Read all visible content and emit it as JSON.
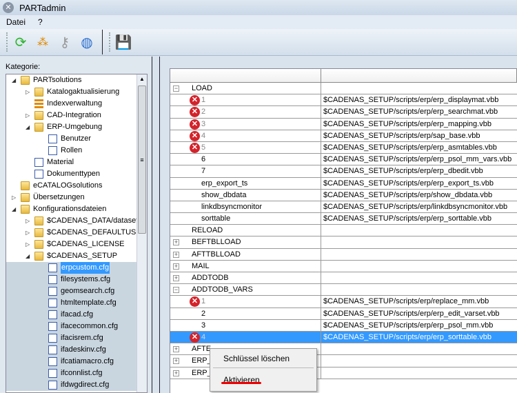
{
  "window": {
    "title": "PARTadmin"
  },
  "menu": [
    "Datei",
    "?"
  ],
  "toolbar": {
    "icons": [
      "refresh-icon",
      "tree-structure-icon",
      "keys-icon",
      "update-globe-icon",
      "save-icon"
    ]
  },
  "left": {
    "label": "Kategorie:",
    "tree": [
      {
        "label": "PARTsolutions",
        "level": 0,
        "icon": "folder",
        "exp": "open"
      },
      {
        "label": "Katalogaktualisierung",
        "level": 1,
        "icon": "folder",
        "exp": "closed"
      },
      {
        "label": "Indexverwaltung",
        "level": 1,
        "icon": "tree",
        "exp": ""
      },
      {
        "label": "CAD-Integration",
        "level": 1,
        "icon": "folder",
        "exp": "closed"
      },
      {
        "label": "ERP-Umgebung",
        "level": 1,
        "icon": "folder",
        "exp": "open"
      },
      {
        "label": "Benutzer",
        "level": 2,
        "icon": "doc",
        "exp": ""
      },
      {
        "label": "Rollen",
        "level": 2,
        "icon": "doc",
        "exp": ""
      },
      {
        "label": "Material",
        "level": 1,
        "icon": "doc",
        "exp": ""
      },
      {
        "label": "Dokumenttypen",
        "level": 1,
        "icon": "doc",
        "exp": ""
      },
      {
        "label": "eCATALOGsolutions",
        "level": 0,
        "icon": "folder",
        "exp": ""
      },
      {
        "label": "Übersetzungen",
        "level": 0,
        "icon": "folder",
        "exp": "closed"
      },
      {
        "label": "Konfigurationsdateien",
        "level": 0,
        "icon": "folder",
        "exp": "open"
      },
      {
        "label": "$CADENAS_DATA/datasetup",
        "level": 1,
        "icon": "folder",
        "exp": "closed"
      },
      {
        "label": "$CADENAS_DEFAULTUSER",
        "level": 1,
        "icon": "folder",
        "exp": "closed"
      },
      {
        "label": "$CADENAS_LICENSE",
        "level": 1,
        "icon": "folder",
        "exp": "closed"
      },
      {
        "label": "$CADENAS_SETUP",
        "level": 1,
        "icon": "folder",
        "exp": "open"
      },
      {
        "label": "erpcustom.cfg",
        "level": 2,
        "icon": "doc",
        "exp": "",
        "selected": true
      },
      {
        "label": "filesystems.cfg",
        "level": 2,
        "icon": "doc",
        "exp": ""
      },
      {
        "label": "geomsearch.cfg",
        "level": 2,
        "icon": "doc",
        "exp": ""
      },
      {
        "label": "htmltemplate.cfg",
        "level": 2,
        "icon": "doc",
        "exp": ""
      },
      {
        "label": "ifacad.cfg",
        "level": 2,
        "icon": "doc",
        "exp": ""
      },
      {
        "label": "ifacecommon.cfg",
        "level": 2,
        "icon": "doc",
        "exp": ""
      },
      {
        "label": "ifacisrem.cfg",
        "level": 2,
        "icon": "doc",
        "exp": ""
      },
      {
        "label": "ifadeskinv.cfg",
        "level": 2,
        "icon": "doc",
        "exp": ""
      },
      {
        "label": "ifcatiamacro.cfg",
        "level": 2,
        "icon": "doc",
        "exp": ""
      },
      {
        "label": "ifconnlist.cfg",
        "level": 2,
        "icon": "doc",
        "exp": ""
      },
      {
        "label": "ifdwgdirect.cfg",
        "level": 2,
        "icon": "doc",
        "exp": ""
      }
    ]
  },
  "grid": {
    "rows": [
      {
        "key": "LOAD",
        "value": "",
        "exp": "minus",
        "indent": 0
      },
      {
        "key": "1",
        "value": "$CADENAS_SETUP/scripts/erp/erp_displaymat.vbb",
        "err": true,
        "indent": 1
      },
      {
        "key": "2",
        "value": "$CADENAS_SETUP/scripts/erp/erp_searchmat.vbb",
        "err": true,
        "indent": 1
      },
      {
        "key": "3",
        "value": "$CADENAS_SETUP/scripts/erp/erp_mapping.vbb",
        "err": true,
        "indent": 1
      },
      {
        "key": "4",
        "value": "$CADENAS_SETUP/scripts/erp/sap_base.vbb",
        "err": true,
        "indent": 1
      },
      {
        "key": "5",
        "value": "$CADENAS_SETUP/scripts/erp/erp_asmtables.vbb",
        "err": true,
        "indent": 1
      },
      {
        "key": "6",
        "value": "$CADENAS_SETUP/scripts/erp/erp_psol_mm_vars.vbb",
        "indent": 1
      },
      {
        "key": "7",
        "value": "$CADENAS_SETUP/scripts/erp/erp_dbedit.vbb",
        "indent": 1
      },
      {
        "key": "erp_export_ts",
        "value": "$CADENAS_SETUP/scripts/erp/erp_export_ts.vbb",
        "indent": 1
      },
      {
        "key": "show_dbdata",
        "value": "$CADENAS_SETUP/scripts/erp/show_dbdata.vbb",
        "indent": 1
      },
      {
        "key": "linkdbsyncmonitor",
        "value": "$CADENAS_SETUP/scripts/erp/linkdbsyncmonitor.vbb",
        "indent": 1
      },
      {
        "key": "sorttable",
        "value": "$CADENAS_SETUP/scripts/erp/erp_sorttable.vbb",
        "indent": 1
      },
      {
        "key": "RELOAD",
        "value": "",
        "indent": 0
      },
      {
        "key": "BEFTBLLOAD",
        "value": "",
        "exp": "plus",
        "indent": 0
      },
      {
        "key": "AFTTBLLOAD",
        "value": "",
        "exp": "plus",
        "indent": 0
      },
      {
        "key": "MAIL",
        "value": "",
        "exp": "plus",
        "indent": 0
      },
      {
        "key": "ADDTODB",
        "value": "",
        "exp": "plus",
        "indent": 0
      },
      {
        "key": "ADDTODB_VARS",
        "value": "",
        "exp": "minus",
        "indent": 0
      },
      {
        "key": "1",
        "value": "$CADENAS_SETUP/scripts/erp/replace_mm.vbb",
        "err": true,
        "indent": 1
      },
      {
        "key": "2",
        "value": "$CADENAS_SETUP/scripts/erp/erp_edit_varset.vbb",
        "indent": 1
      },
      {
        "key": "3",
        "value": "$CADENAS_SETUP/scripts/erp/erp_psol_mm.vbb",
        "indent": 1
      },
      {
        "key": "4",
        "value": "$CADENAS_SETUP/scripts/erp/erp_sorttable.vbb",
        "err": true,
        "indent": 1,
        "selected": true
      },
      {
        "key": "AFTE",
        "value": "",
        "exp": "plus",
        "indent": 0
      },
      {
        "key": "ERP_",
        "value": "",
        "exp": "plus",
        "indent": 0
      },
      {
        "key": "ERP_",
        "value": "",
        "exp": "plus",
        "indent": 0
      }
    ]
  },
  "context_menu": {
    "items": [
      "Schlüssel löschen",
      "Aktivieren"
    ]
  },
  "colors": {
    "selection": "#3399ff",
    "error": "#d5222a"
  }
}
